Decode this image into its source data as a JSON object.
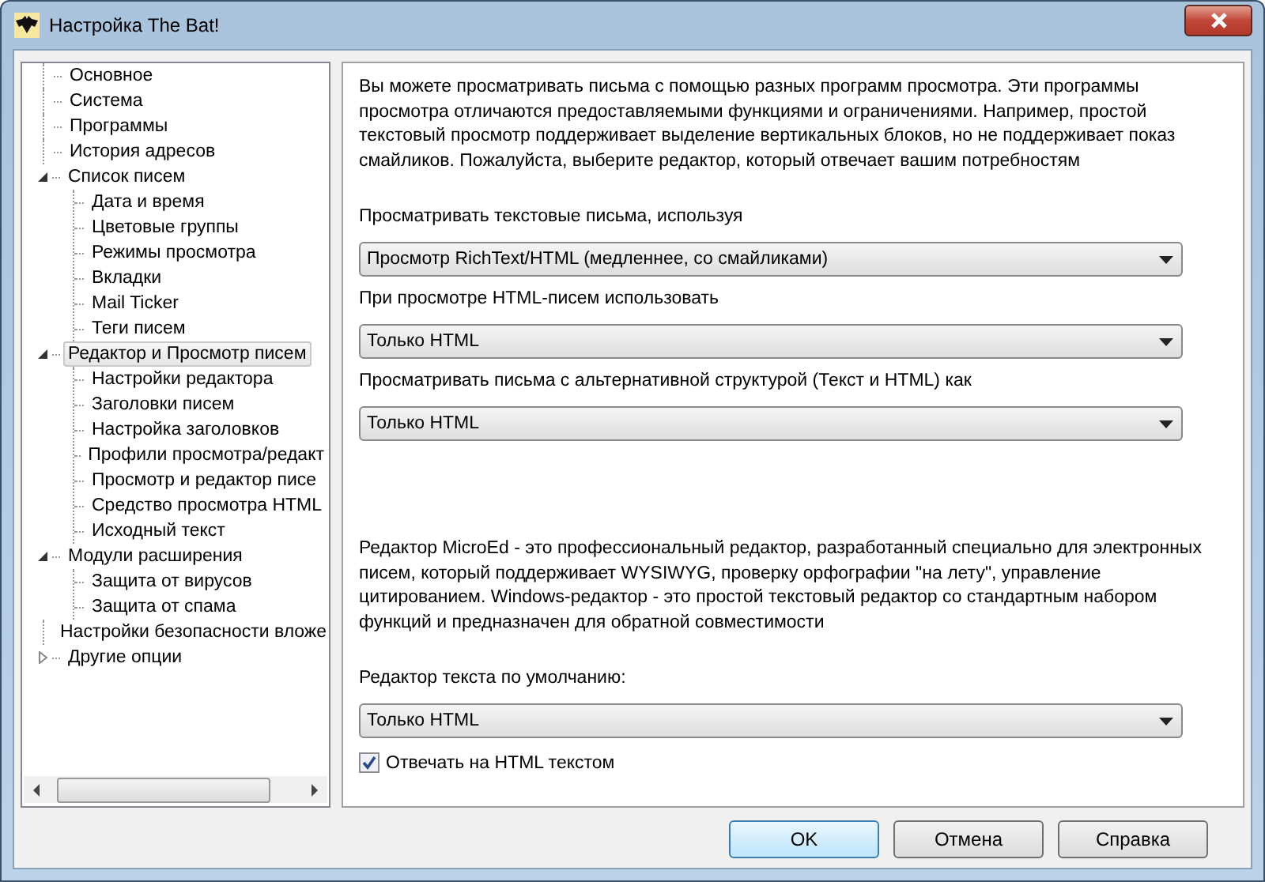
{
  "window": {
    "title": "Настройка The Bat!"
  },
  "tree": [
    {
      "label": "Основное",
      "selected": false
    },
    {
      "label": "Система",
      "selected": false
    },
    {
      "label": "Программы",
      "selected": false
    },
    {
      "label": "История адресов",
      "selected": false
    },
    {
      "label": "Список писем",
      "selected": false,
      "expanded": true,
      "children": [
        {
          "label": "Дата и время",
          "selected": false
        },
        {
          "label": "Цветовые группы",
          "selected": false
        },
        {
          "label": "Режимы просмотра",
          "selected": false
        },
        {
          "label": "Вкладки",
          "selected": false
        },
        {
          "label": "Mail Ticker",
          "selected": false
        },
        {
          "label": "Теги писем",
          "selected": false
        }
      ]
    },
    {
      "label": "Редактор и Просмотр писем",
      "selected": true,
      "expanded": true,
      "children": [
        {
          "label": "Настройки редактора",
          "selected": false
        },
        {
          "label": "Заголовки писем",
          "selected": false
        },
        {
          "label": "Настройка заголовков",
          "selected": false
        },
        {
          "label": "Профили просмотра/редакт",
          "selected": false
        },
        {
          "label": "Просмотр и редактор писе",
          "selected": false
        },
        {
          "label": "Средство просмотра HTML",
          "selected": false
        },
        {
          "label": "Исходный текст",
          "selected": false
        }
      ]
    },
    {
      "label": "Модули расширения",
      "selected": false,
      "expanded": true,
      "children": [
        {
          "label": "Защита от вирусов",
          "selected": false
        },
        {
          "label": "Защита от спама",
          "selected": false
        }
      ]
    },
    {
      "label": "Настройки безопасности вложе",
      "selected": false
    },
    {
      "label": "Другие опции",
      "selected": false,
      "expanded": false
    }
  ],
  "groups": [
    {
      "items": [
        {
          "kind": "paragraph",
          "text": "Вы можете просматривать письма с помощью разных программ просмотра. Эти программы просмотра отличаются предоставляемыми функциями и ограничениями. Например, простой текстовый просмотр поддерживает выделение вертикальных блоков, но не поддерживает показ смайликов. Пожалуйста, выберите редактор, который отвечает вашим потребностям"
        },
        {
          "kind": "label",
          "text": "Просматривать текстовые письма, используя"
        },
        {
          "kind": "dropdown",
          "value": "Просмотр RichText/HTML (медленнее, со смайликами)"
        },
        {
          "kind": "label",
          "text": "При просмотре HTML-писем использовать"
        },
        {
          "kind": "dropdown",
          "value": "Только HTML"
        },
        {
          "kind": "label",
          "text": "Просматривать письма с альтернативной структурой (Текст и HTML) как"
        },
        {
          "kind": "dropdown",
          "value": "Только HTML"
        }
      ]
    },
    {
      "items": [
        {
          "kind": "paragraph",
          "text": "Редактор MicroEd - это профессиональный редактор, разработанный специально для электронных писем, который поддерживает WYSIWYG, проверку орфографии \"на лету\", управление цитированием. Windows-редактор - это простой текстовый редактор со стандартным набором функций и предназначен для обратной совместимости"
        },
        {
          "kind": "label",
          "text": "Редактор текста по умолчанию:"
        },
        {
          "kind": "dropdown",
          "value": "Только HTML"
        },
        {
          "kind": "checkbox",
          "label": "Отвечать на HTML текстом",
          "checked": true
        }
      ]
    }
  ],
  "buttons": [
    {
      "label": "OK",
      "default": true
    },
    {
      "label": "Отмена",
      "default": false
    },
    {
      "label": "Справка",
      "default": false
    }
  ]
}
